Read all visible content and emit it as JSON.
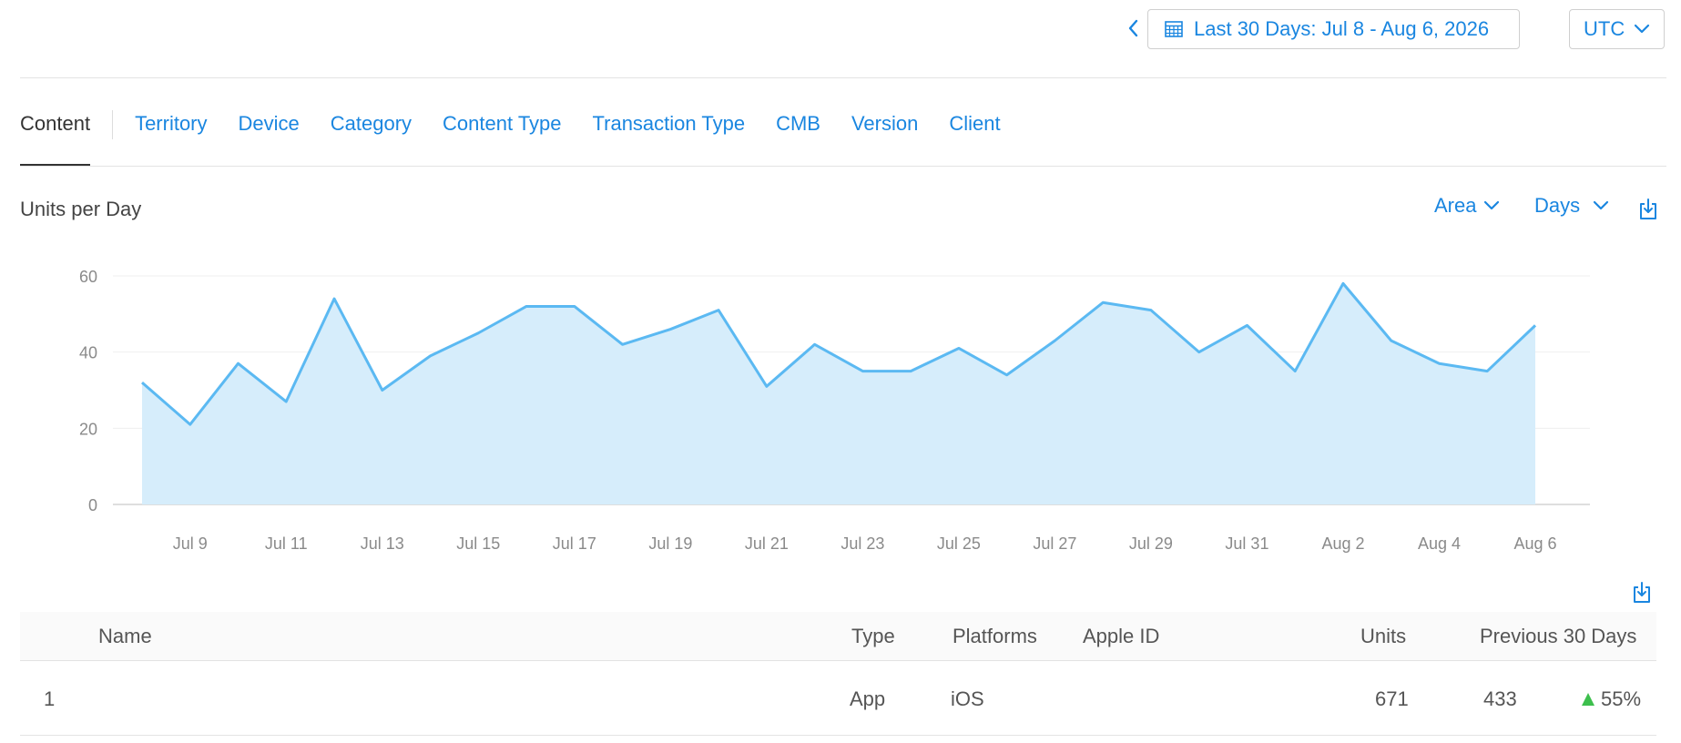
{
  "header": {
    "date_range_label": "Last 30 Days: Jul 8 - Aug 6, 2026",
    "timezone": "UTC",
    "icons": {
      "prev": "chevron-left-icon",
      "calendar": "calendar-icon",
      "dropdown": "chevron-down-icon"
    }
  },
  "tabs": [
    {
      "label": "Content",
      "active": true
    },
    {
      "label": "Territory",
      "active": false
    },
    {
      "label": "Device",
      "active": false
    },
    {
      "label": "Category",
      "active": false
    },
    {
      "label": "Content Type",
      "active": false
    },
    {
      "label": "Transaction Type",
      "active": false
    },
    {
      "label": "CMB",
      "active": false
    },
    {
      "label": "Version",
      "active": false
    },
    {
      "label": "Client",
      "active": false
    }
  ],
  "chart_header": {
    "title": "Units per Day",
    "type_label": "Area",
    "period_label": "Days",
    "download_icon": "download-icon"
  },
  "colors": {
    "accent": "#1a86e0",
    "series_line": "#5bb9f2",
    "series_fill": "#d6edfb",
    "positive": "#3dbf4d"
  },
  "chart_data": {
    "type": "area",
    "title": "Units per Day",
    "xlabel": "",
    "ylabel": "",
    "ylim": [
      0,
      60
    ],
    "yticks": [
      0,
      20,
      40,
      60
    ],
    "grid": true,
    "x": [
      "Jul 8",
      "Jul 9",
      "Jul 10",
      "Jul 11",
      "Jul 12",
      "Jul 13",
      "Jul 14",
      "Jul 15",
      "Jul 16",
      "Jul 17",
      "Jul 18",
      "Jul 19",
      "Jul 20",
      "Jul 21",
      "Jul 22",
      "Jul 23",
      "Jul 24",
      "Jul 25",
      "Jul 26",
      "Jul 27",
      "Jul 28",
      "Jul 29",
      "Jul 30",
      "Jul 31",
      "Aug 1",
      "Aug 2",
      "Aug 3",
      "Aug 4",
      "Aug 5",
      "Aug 6"
    ],
    "xtick_labels": [
      "Jul 9",
      "Jul 11",
      "Jul 13",
      "Jul 15",
      "Jul 17",
      "Jul 19",
      "Jul 21",
      "Jul 23",
      "Jul 25",
      "Jul 27",
      "Jul 29",
      "Jul 31",
      "Aug 2",
      "Aug 4",
      "Aug 6"
    ],
    "series": [
      {
        "values": [
          32,
          21,
          37,
          27,
          54,
          30,
          39,
          45,
          52,
          52,
          42,
          46,
          51,
          31,
          42,
          35,
          35,
          41,
          34,
          43,
          53,
          51,
          40,
          47,
          35,
          58,
          43,
          37,
          35,
          47
        ]
      }
    ]
  },
  "table": {
    "columns": [
      "Name",
      "Type",
      "Platforms",
      "Apple ID",
      "Units",
      "Previous 30 Days"
    ],
    "rows": [
      {
        "rank": "1",
        "name": "",
        "type": "App",
        "platforms": "iOS",
        "apple_id": "",
        "units": "671",
        "previous": "433",
        "change": "55%",
        "change_icon": "triangle-up-icon"
      }
    ],
    "download_icon": "download-icon"
  }
}
